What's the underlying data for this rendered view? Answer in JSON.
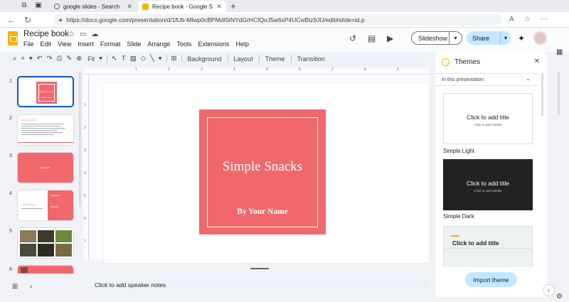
{
  "browser": {
    "tabs": [
      {
        "title": "google slides - Search",
        "active": false
      },
      {
        "title": "Recipe book - Google Slides",
        "active": true
      }
    ],
    "new_tab_label": "+",
    "url": "https://docs.google.com/presentation/d/1fUb-Mlwp0cBPMdlSiNYdGrHCfQoJ5w6xP4UCwBiz9JU/edit#slide=id.p"
  },
  "app": {
    "doc_title": "Recipe book",
    "menus": [
      "File",
      "Edit",
      "View",
      "Insert",
      "Format",
      "Slide",
      "Arrange",
      "Tools",
      "Extensions",
      "Help"
    ],
    "slideshow_label": "Slideshow",
    "share_label": "Share"
  },
  "toolbar": {
    "zoom": "Fit",
    "background_label": "Background",
    "layout_label": "Layout",
    "theme_label": "Theme",
    "transition_label": "Transition"
  },
  "ruler": {
    "h_ticks": [
      "1",
      "2",
      "3",
      "4",
      "5",
      "6",
      "7",
      "8",
      "9"
    ],
    "v_ticks": [
      "1",
      "2",
      "3",
      "4",
      "5",
      "6",
      "7"
    ]
  },
  "filmstrip": {
    "slide_numbers": [
      "1",
      "2",
      "3",
      "4",
      "5",
      "6"
    ],
    "slide1": {
      "title": "Simple Snacks",
      "subtitle": "By Your Name"
    },
    "slide2": {
      "title": "About the chef"
    },
    "slide3": {
      "title": "Recipes"
    },
    "slide4": {
      "title": "Recipe name",
      "right_heading_1": "Ingredients",
      "right_heading_2": "Directions"
    }
  },
  "slide": {
    "title": "Simple Snacks",
    "subtitle": "By Your Name",
    "accent_color": "#f0686c"
  },
  "notes": {
    "placeholder": "Click to add speaker notes"
  },
  "themes_panel": {
    "title": "Themes",
    "filter_label": "In this presentation",
    "themes": [
      {
        "name": "Simple Light",
        "card_title": "Click to add title",
        "card_subtitle": "Click to add subtitle"
      },
      {
        "name": "Simple Dark",
        "card_title": "Click to add title",
        "card_subtitle": "Click to add subtitle"
      },
      {
        "name": "",
        "card_title": "Click to add title",
        "card_subtitle": ""
      }
    ],
    "import_label": "Import theme"
  },
  "colors": {
    "accent": "#f0686c",
    "share_bg": "#c2e7ff",
    "selected_border": "#0b57d0",
    "slides_yellow": "#f4b400"
  }
}
